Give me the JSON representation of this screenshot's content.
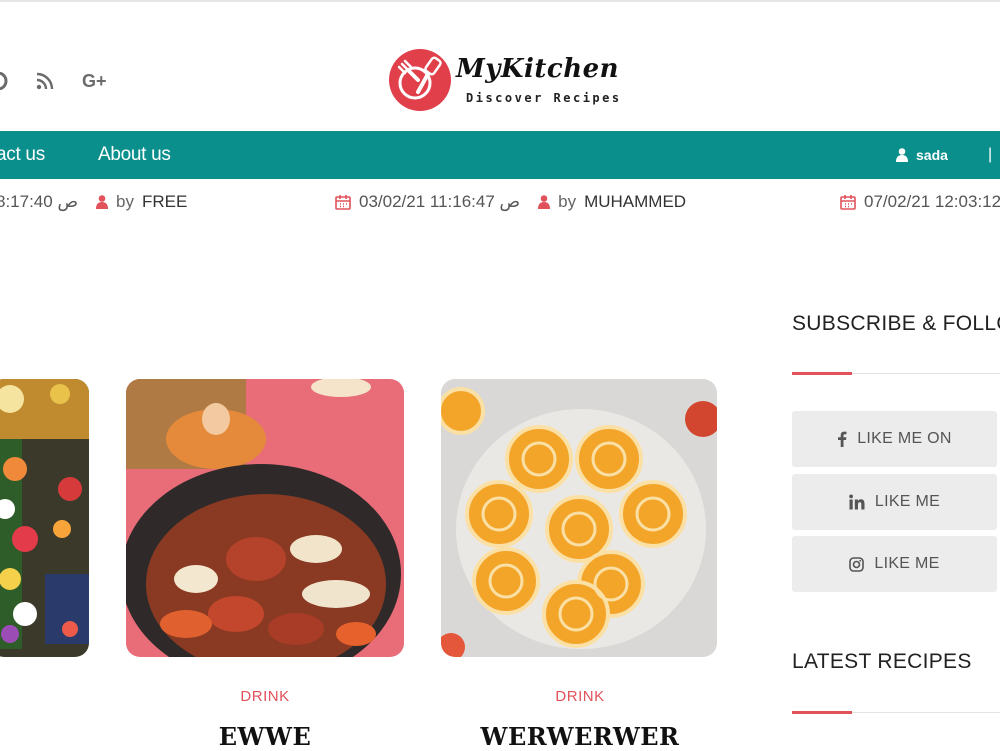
{
  "header": {
    "social": [
      "skype-icon",
      "rss-icon",
      "google-plus-icon"
    ],
    "google_plus_text": "G+"
  },
  "logo": {
    "name": "MyKitchen",
    "tagline": "Discover Recipes"
  },
  "nav": {
    "items": [
      "act us",
      "About us"
    ],
    "user": "sada",
    "separator": "|"
  },
  "ticker": [
    {
      "date": "8:17:40 ص",
      "by": "by",
      "author": "FREE"
    },
    {
      "date": "03/02/21 11:16:47 ص",
      "by": "by",
      "author": "MUHAMMED"
    },
    {
      "date": "07/02/21 12:03:12",
      "by": "",
      "author": ""
    }
  ],
  "posts": [
    {
      "category": "",
      "title": "",
      "image": "market-flowers-photo"
    },
    {
      "category": "DRINK",
      "title": "EWWE",
      "image": "tagine-sausage-photo"
    },
    {
      "category": "DRINK",
      "title": "WERWERWER",
      "image": "pinwheel-cookies-photo"
    }
  ],
  "sidebar": {
    "subscribe_title": "SUBSCRIBE & FOLLO",
    "buttons": [
      {
        "icon": "facebook-icon",
        "label": "LIKE ME ON"
      },
      {
        "icon": "linkedin-icon",
        "label": "LIKE ME"
      },
      {
        "icon": "instagram-icon",
        "label": "LIKE ME"
      }
    ],
    "latest_title": "LATEST RECIPES"
  },
  "colors": {
    "nav": "#0b8f8c",
    "accent": "#e1525a"
  }
}
